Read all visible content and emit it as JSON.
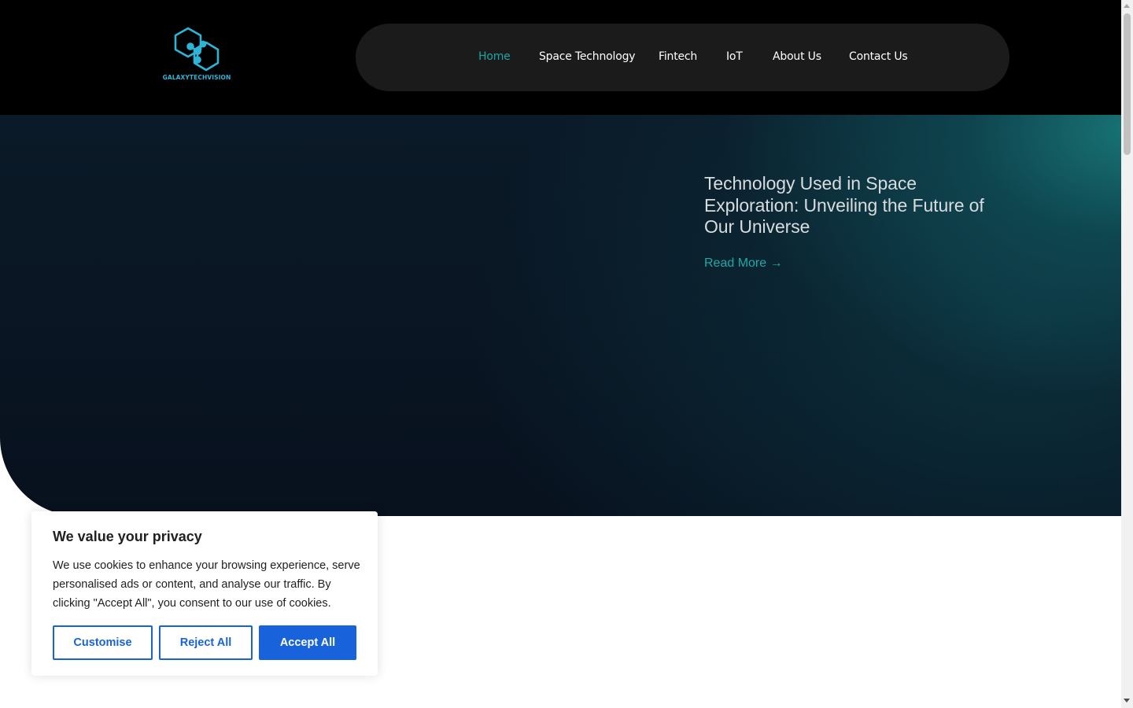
{
  "header": {
    "logo": {
      "text": "GALAXYTECHVISION",
      "icon": "hexagon-molecule-logo-icon",
      "color": "#2eb5d6"
    },
    "nav": {
      "items": [
        {
          "label": "Home",
          "active": true
        },
        {
          "label": "Space Technology",
          "active": false
        },
        {
          "label": "Fintech",
          "active": false
        },
        {
          "label": "IoT",
          "active": false
        },
        {
          "label": "About Us",
          "active": false
        },
        {
          "label": "Contact Us",
          "active": false
        }
      ],
      "active_color": "#1aa6a6"
    }
  },
  "hero": {
    "article": {
      "title": "Technology Used in Space Exploration: Unveiling the Future of Our Universe",
      "read_more": "Read More →"
    }
  },
  "cookie_banner": {
    "title": "We value your privacy",
    "text": "We use cookies to enhance your browsing experience, serve personalised ads or content, and analyse our traffic. By clicking \"Accept All\", you consent to our use of cookies.",
    "buttons": {
      "customise": "Customise",
      "reject": "Reject All",
      "accept": "Accept All"
    },
    "accent_color": "#1863dc"
  }
}
